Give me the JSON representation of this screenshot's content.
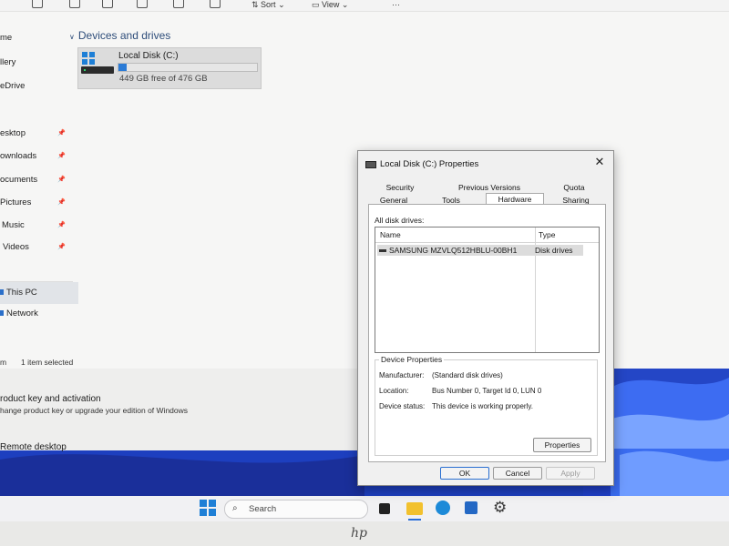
{
  "toolbar": {
    "sort": "Sort",
    "view": "View"
  },
  "nav": {
    "items": [
      {
        "label": "me"
      },
      {
        "label": "llery"
      },
      {
        "label": "eDrive"
      },
      {
        "label": "esktop"
      },
      {
        "label": "ownloads"
      },
      {
        "label": "ocuments"
      },
      {
        "label": "Pictures"
      },
      {
        "label": "Music"
      },
      {
        "label": "Videos"
      },
      {
        "label": "This PC"
      },
      {
        "label": "Network"
      }
    ]
  },
  "main": {
    "section_header": "Devices and drives",
    "drive": {
      "name": "Local Disk (C:)",
      "free_text": "449 GB free of 476 GB",
      "used_fraction": 0.057
    }
  },
  "status": {
    "left": "m",
    "selected": "1 item selected"
  },
  "settings": {
    "product_key_title": "roduct key and activation",
    "product_key_sub": "hange product key or upgrade your edition of Windows",
    "remote_desktop": "Remote desktop"
  },
  "taskbar": {
    "search_placeholder": "Search"
  },
  "dialog": {
    "title": "Local Disk (C:) Properties",
    "tabs_top": [
      "Security",
      "Previous Versions",
      "Quota"
    ],
    "tabs_bottom": [
      "General",
      "Tools",
      "Hardware",
      "Sharing"
    ],
    "active_tab": "Hardware",
    "all_disks_label": "All disk drives:",
    "columns": [
      "Name",
      "Type"
    ],
    "rows": [
      {
        "name": "SAMSUNG MZVLQ512HBLU-00BH1",
        "type": "Disk drives"
      }
    ],
    "device_properties": {
      "legend": "Device Properties",
      "manufacturer_label": "Manufacturer:",
      "manufacturer_value": "(Standard disk drives)",
      "location_label": "Location:",
      "location_value": "Bus Number 0, Target Id 0, LUN 0",
      "status_label": "Device status:",
      "status_value": "This device is working properly."
    },
    "properties_button": "Properties",
    "ok": "OK",
    "cancel": "Cancel",
    "apply": "Apply"
  },
  "colors": {
    "accent": "#2b7bd6",
    "wallpaper": "#1d3fbf"
  }
}
